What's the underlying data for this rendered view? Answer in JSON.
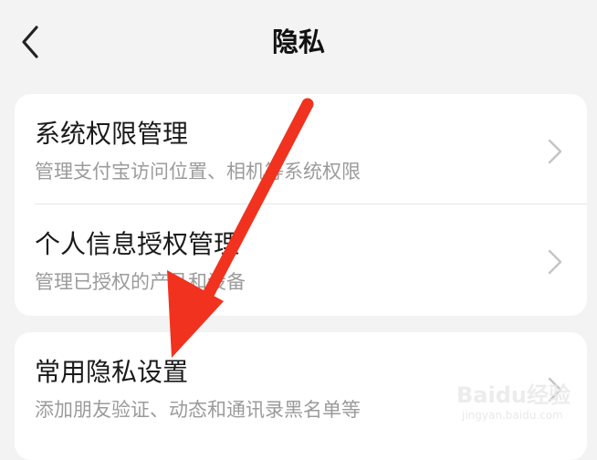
{
  "header": {
    "title": "隐私"
  },
  "sections": [
    {
      "items": [
        {
          "title": "系统权限管理",
          "subtitle": "管理支付宝访问位置、相机等系统权限"
        },
        {
          "title": "个人信息授权管理",
          "subtitle": "管理已授权的产品和设备"
        }
      ]
    },
    {
      "items": [
        {
          "title": "常用隐私设置",
          "subtitle": "添加朋友验证、动态和通讯录黑名单等"
        }
      ]
    }
  ],
  "annotation": {
    "arrow_color": "#f0321f"
  },
  "watermark": {
    "brand": "Baidu经验",
    "url": "jingyan.baidu.com"
  }
}
